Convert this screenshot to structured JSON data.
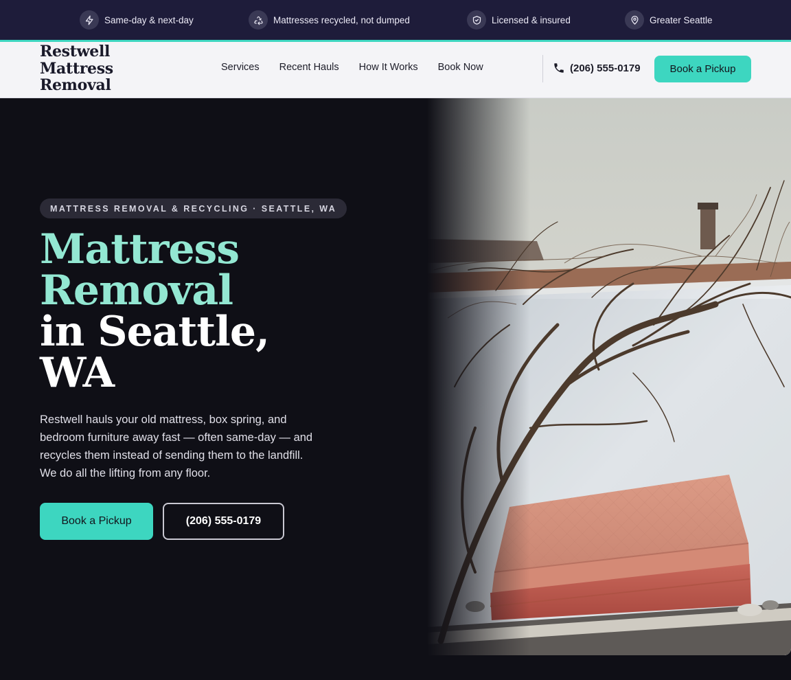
{
  "topbar": {
    "items": [
      {
        "icon": "lightning-icon",
        "label": "Same-day & next-day"
      },
      {
        "icon": "recycle-icon",
        "label": "Mattresses recycled, not dumped"
      },
      {
        "icon": "shield-check-icon",
        "label": "Licensed & insured"
      },
      {
        "icon": "map-pin-icon",
        "label": "Greater Seattle"
      }
    ]
  },
  "header": {
    "logo_lines": [
      "Restwell",
      "Mattress",
      "Removal"
    ],
    "nav": [
      "Services",
      "Recent Hauls",
      "How It Works",
      "Book Now"
    ],
    "phone": "(206) 555-0179",
    "cta": "Book a Pickup"
  },
  "hero": {
    "eyebrow": "MATTRESS REMOVAL & RECYCLING · SEATTLE, WA",
    "headline": {
      "accent_lines": [
        "Mattress",
        "Removal"
      ],
      "plain_lines": [
        "in Seattle,",
        "WA"
      ]
    },
    "lede": "Restwell hauls your old mattress, box spring, and bedroom furniture away fast — often same-day — and recycles them instead of sending them to the landfill. We do all the lifting from any floor.",
    "primary_cta": "Book a Pickup",
    "secondary_cta": "(206) 555-0179",
    "image_icon": "mattress-photo"
  },
  "colors": {
    "accent": "#3dd6c0",
    "headline_accent": "#93e7d2",
    "topbar_bg": "#1e1c3a",
    "hero_bg": "#0f0f16",
    "header_bg": "#f4f4f7"
  }
}
